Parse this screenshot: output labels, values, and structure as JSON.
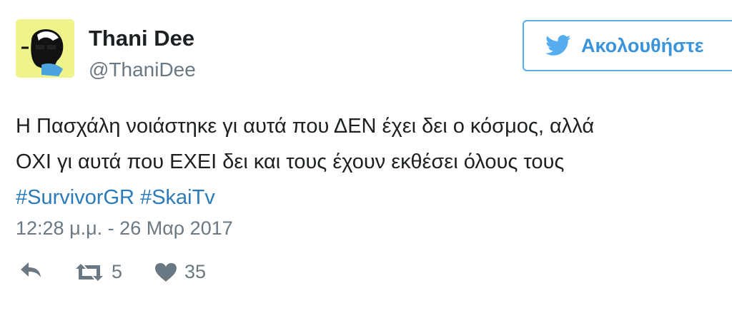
{
  "author": {
    "name": "Thani Dee",
    "handle": "@ThaniDee"
  },
  "follow_button": {
    "label": "Ακολουθήστε",
    "icon": "twitter-bird-icon"
  },
  "tweet": {
    "lines": [
      "Η Πασχάλη νοιάστηκε γι αυτά που ΔΕΝ έχει δει ο κόσμος, αλλά",
      "ΟΧΙ γι αυτά που ΕΧΕΙ δει και τους έχουν εκθέσει όλους τους"
    ],
    "hashtags": [
      "#SurvivorGR",
      "#SkaiTv"
    ],
    "timestamp": "12:28 μ.μ. - 26 Μαρ 2017"
  },
  "actions": {
    "reply": {
      "icon": "reply-icon"
    },
    "retweet": {
      "icon": "retweet-icon",
      "count": "5"
    },
    "like": {
      "icon": "heart-icon",
      "count": "35"
    }
  },
  "colors": {
    "brand_blue": "#55acee",
    "hashtag_blue": "#2b7bb9",
    "text_dark": "#1c2022",
    "text_gray": "#697882",
    "avatar_bg": "#eef48a"
  }
}
